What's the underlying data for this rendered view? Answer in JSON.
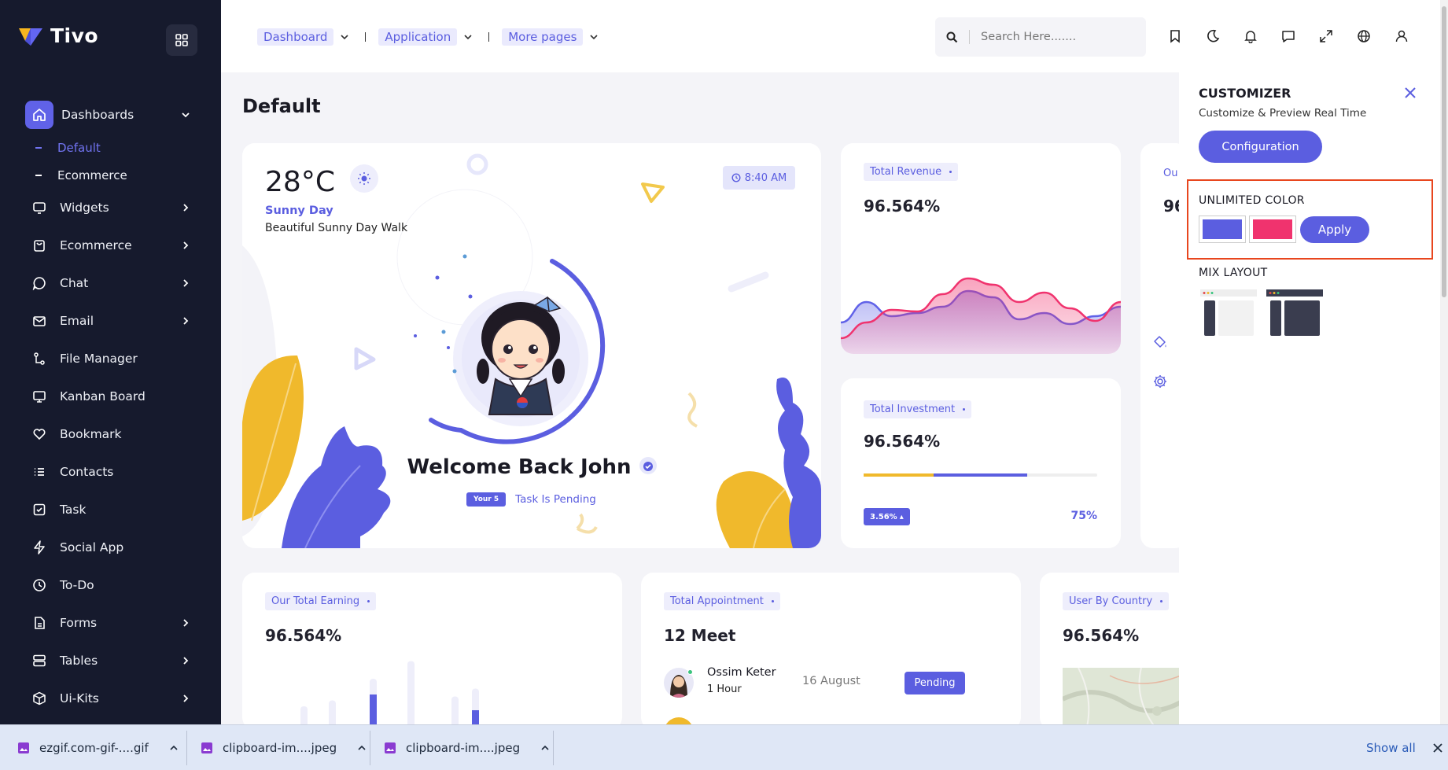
{
  "brand": {
    "name": "Tivo"
  },
  "sidebar": {
    "items": [
      {
        "label": "Dashboards",
        "icon": "home-icon",
        "active": true,
        "chevron": "down"
      },
      {
        "label": "Widgets",
        "icon": "widgets-icon",
        "chevron": "right"
      },
      {
        "label": "Ecommerce",
        "icon": "bag-icon",
        "chevron": "right"
      },
      {
        "label": "Chat",
        "icon": "chat-icon",
        "chevron": "right"
      },
      {
        "label": "Email",
        "icon": "mail-icon",
        "chevron": "right"
      },
      {
        "label": "File Manager",
        "icon": "file-manager-icon"
      },
      {
        "label": "Kanban Board",
        "icon": "monitor-icon"
      },
      {
        "label": "Bookmark",
        "icon": "heart-icon"
      },
      {
        "label": "Contacts",
        "icon": "list-icon"
      },
      {
        "label": "Task",
        "icon": "check-square-icon"
      },
      {
        "label": "Social App",
        "icon": "bolt-icon"
      },
      {
        "label": "To-Do",
        "icon": "clock-icon"
      },
      {
        "label": "Forms",
        "icon": "form-icon",
        "chevron": "right"
      },
      {
        "label": "Tables",
        "icon": "table-icon",
        "chevron": "right"
      },
      {
        "label": "Ui-Kits",
        "icon": "box-icon",
        "chevron": "right"
      }
    ],
    "subitems": [
      {
        "label": "Default",
        "active": true
      },
      {
        "label": "Ecommerce"
      }
    ]
  },
  "header": {
    "nav": [
      {
        "label": "Dashboard"
      },
      {
        "label": "Application"
      },
      {
        "label": "More pages"
      }
    ],
    "search_placeholder": "Search Here......."
  },
  "page": {
    "title": "Default"
  },
  "welcome_card": {
    "temperature": "28",
    "unit": "°C",
    "condition": "Sunny Day",
    "subtitle": "Beautiful Sunny Day Walk",
    "time": "8:40 AM",
    "greeting": "Welcome Back John",
    "badge": "Your 5",
    "pending": "Task Is Pending"
  },
  "revenue_card": {
    "label": "Total Revenue",
    "value": "96.564%",
    "chart_data": {
      "type": "area",
      "series": [
        {
          "values": [
            32,
            58,
            40,
            44,
            52,
            72,
            64,
            36,
            44,
            30,
            40,
            52
          ]
        },
        {
          "values": [
            12,
            32,
            48,
            46,
            68,
            88,
            80,
            58,
            70,
            50,
            34,
            58
          ]
        }
      ],
      "colors": [
        "#6062e8",
        "#f0336e"
      ]
    }
  },
  "investment_card": {
    "label": "Total Investment",
    "value": "96.564%",
    "badge": "3.56%",
    "percent": "75%",
    "progress_yellow": 0.3,
    "progress_blue": 0.7
  },
  "partial_card": {
    "label": "Ou",
    "value": "96"
  },
  "earning_card": {
    "label": "Our Total Earning",
    "value": "96.564%",
    "chart_data": {
      "type": "bar",
      "series": [
        {
          "values": [
            24,
            30,
            52,
            70,
            34,
            42
          ]
        },
        {
          "values": [
            0,
            0,
            36,
            0,
            0,
            20
          ]
        }
      ]
    }
  },
  "appointment_card": {
    "label": "Total Appointment",
    "value": "12 Meet",
    "row": {
      "name": "Ossim Keter",
      "duration": "1 Hour",
      "date": "16 August",
      "status": "Pending"
    }
  },
  "country_card": {
    "label": "User By Country",
    "value": "96.564%"
  },
  "customizer": {
    "title": "CUSTOMIZER",
    "subtitle": "Customize & Preview Real Time",
    "config_button": "Configuration",
    "unlimited_color": "UNLIMITED COLOR",
    "apply": "Apply",
    "mix_layout": "MIX LAYOUT",
    "colors": {
      "primary": "#5b5ee0",
      "secondary": "#f0336e"
    }
  },
  "downloads": {
    "items": [
      {
        "name": "ezgif.com-gif-....gif"
      },
      {
        "name": "clipboard-im....jpeg"
      },
      {
        "name": "clipboard-im....jpeg"
      }
    ],
    "show_all": "Show all"
  }
}
